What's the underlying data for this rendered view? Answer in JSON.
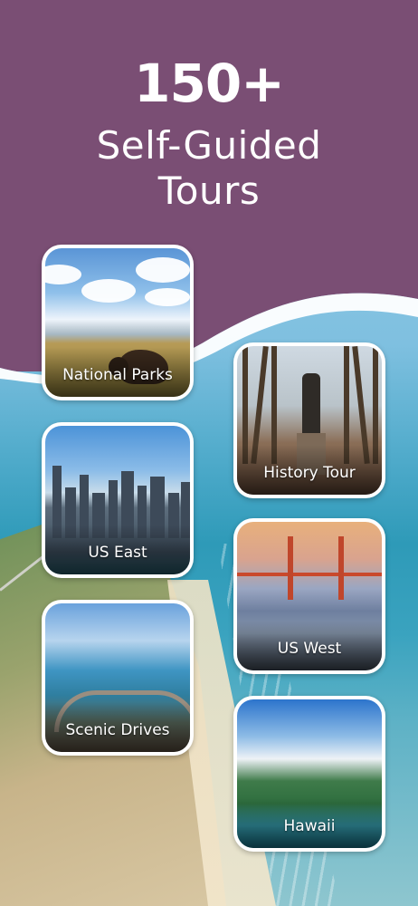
{
  "headline": {
    "count": "150+",
    "line1": "Self-Guided",
    "line2": "Tours"
  },
  "cards": [
    {
      "label": "National Parks"
    },
    {
      "label": "History Tour"
    },
    {
      "label": "US East"
    },
    {
      "label": "US West"
    },
    {
      "label": "Scenic Drives"
    },
    {
      "label": "Hawaii"
    }
  ],
  "colors": {
    "header": "#7a4e74",
    "card_border": "#ffffff",
    "text": "#ffffff"
  }
}
